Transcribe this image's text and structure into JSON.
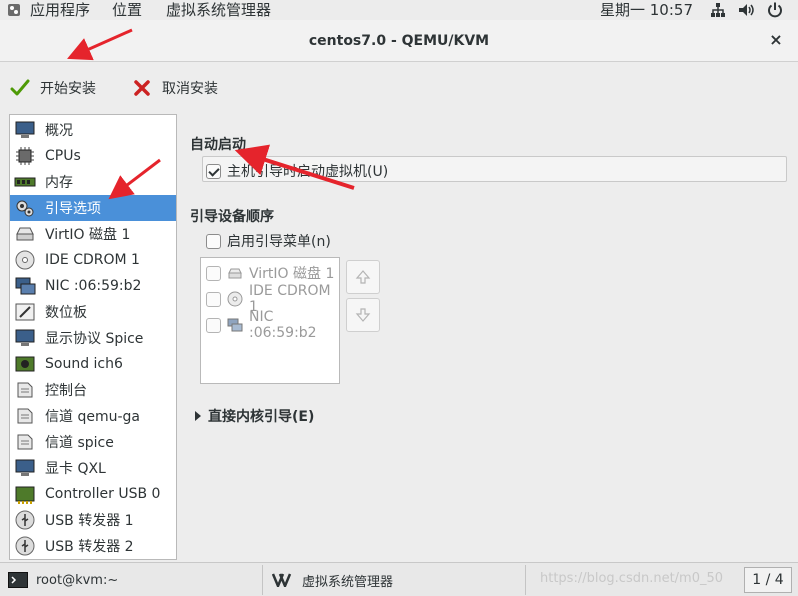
{
  "topbar": {
    "applications": "应用程序",
    "places": "位置",
    "app_name": "虚拟系统管理器",
    "clock": "星期一 10:57"
  },
  "window": {
    "title": "centos7.0 - QEMU/KVM",
    "close": "×"
  },
  "toolbar": {
    "begin_install": "开始安装",
    "cancel_install": "取消安装"
  },
  "sidebar": {
    "items": [
      {
        "label": "概况",
        "icon": "monitor-icon"
      },
      {
        "label": "CPUs",
        "icon": "cpu-icon"
      },
      {
        "label": "内存",
        "icon": "memory-icon"
      },
      {
        "label": "引导选项",
        "icon": "boot-options-icon"
      },
      {
        "label": "VirtIO 磁盘 1",
        "icon": "disk-icon"
      },
      {
        "label": "IDE CDROM 1",
        "icon": "cdrom-icon"
      },
      {
        "label": "NIC :06:59:b2",
        "icon": "nic-icon"
      },
      {
        "label": "数位板",
        "icon": "tablet-icon"
      },
      {
        "label": "显示协议 Spice",
        "icon": "display-icon"
      },
      {
        "label": "Sound ich6",
        "icon": "sound-icon"
      },
      {
        "label": "控制台",
        "icon": "console-icon"
      },
      {
        "label": "信道 qemu-ga",
        "icon": "channel-icon"
      },
      {
        "label": "信道 spice",
        "icon": "channel-icon"
      },
      {
        "label": "显卡 QXL",
        "icon": "video-icon"
      },
      {
        "label": "Controller USB 0",
        "icon": "controller-icon"
      },
      {
        "label": "USB 转发器 1",
        "icon": "usb-icon"
      },
      {
        "label": "USB 转发器 2",
        "icon": "usb-icon"
      }
    ],
    "selected_index": 3
  },
  "autostart": {
    "heading": "自动启动",
    "checkbox_label": "主机引导时启动虚拟机(U)",
    "checked": true
  },
  "boot_order": {
    "heading": "引导设备顺序",
    "menu_label": "启用引导菜单(n)",
    "menu_checked": false,
    "devices": [
      {
        "label": "VirtIO 磁盘 1",
        "icon": "disk-icon",
        "checked": false
      },
      {
        "label": "IDE CDROM 1",
        "icon": "cdrom-icon",
        "checked": false
      },
      {
        "label": "NIC :06:59:b2",
        "icon": "nic-icon",
        "checked": false
      }
    ]
  },
  "direct_kernel": {
    "label": "直接内核引导(E)",
    "expanded": false
  },
  "taskbar": {
    "terminal": "root@kvm:~",
    "virt_manager": "虚拟系统管理器",
    "watermark": "https://blog.csdn.net/m0_50",
    "page": "1 / 4"
  },
  "colors": {
    "selection": "#4a90d9",
    "annotation_arrow": "#e5242c"
  }
}
